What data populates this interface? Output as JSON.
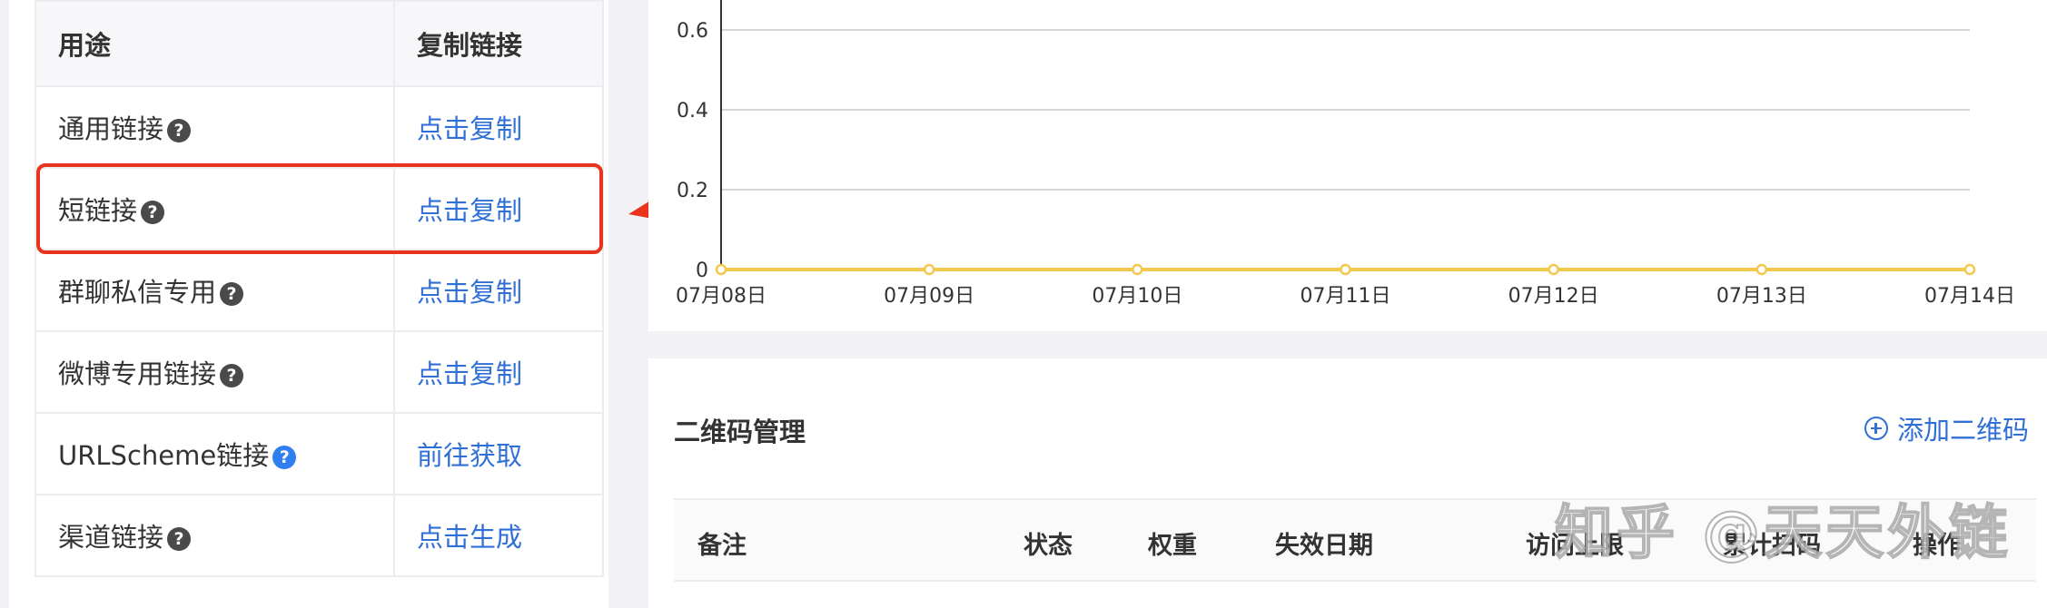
{
  "link_table": {
    "headers": {
      "usage": "用途",
      "copy": "复制链接"
    },
    "rows": [
      {
        "label": "通用链接",
        "help": "?",
        "action": "点击复制"
      },
      {
        "label": "短链接",
        "help": "?",
        "action": "点击复制"
      },
      {
        "label": "群聊私信专用",
        "help": "?",
        "action": "点击复制"
      },
      {
        "label": "微博专用链接",
        "help": "?",
        "action": "点击复制"
      },
      {
        "label": "URLScheme链接",
        "help": "?",
        "action": "前往获取"
      },
      {
        "label": "渠道链接",
        "help": "?",
        "action": "点击生成"
      }
    ]
  },
  "chart_data": {
    "type": "line",
    "title": "",
    "xlabel": "",
    "ylabel": "",
    "x": [
      "07月08日",
      "07月09日",
      "07月10日",
      "07月11日",
      "07月12日",
      "07月13日",
      "07月14日"
    ],
    "y_ticks": [
      "0",
      "0.2",
      "0.4",
      "0.6"
    ],
    "ylim": [
      0,
      0.6
    ],
    "grid": true,
    "series": [
      {
        "values": [
          0,
          0,
          0,
          0,
          0,
          0,
          0
        ],
        "color": "#f2c94c"
      }
    ]
  },
  "qr": {
    "title": "二维码管理",
    "add_label": "添加二维码",
    "columns": [
      "备注",
      "状态",
      "权重",
      "失效日期",
      "访问上限",
      "累计扫码",
      "操作"
    ]
  },
  "watermark": "知乎 @天天外链",
  "colors": {
    "link": "#2f6fd6",
    "highlight": "#e8341c",
    "series": "#f2c94c"
  }
}
